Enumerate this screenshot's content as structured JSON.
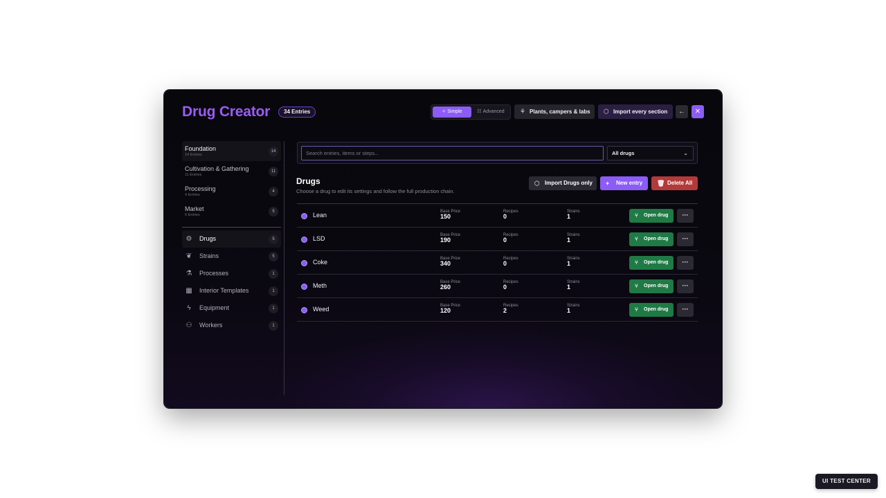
{
  "header": {
    "title": "Drug Creator",
    "entries_badge": "34 Entries",
    "mode": {
      "simple_label": "Simple",
      "advanced_label": "Advanced",
      "selected": "Simple"
    },
    "plants_button": "Plants, campers & labs",
    "import_all_button": "Import every section",
    "back_icon": "←",
    "close_icon": "✕"
  },
  "sidebar": {
    "sections": [
      {
        "name": "Foundation",
        "sub": "14 Entries",
        "count": "14"
      },
      {
        "name": "Cultivation & Gathering",
        "sub": "11 Entries",
        "count": "11"
      },
      {
        "name": "Processing",
        "sub": "4 Entries",
        "count": "4"
      },
      {
        "name": "Market",
        "sub": "5 Entries",
        "count": "5"
      }
    ],
    "categories": [
      {
        "label": "Drugs",
        "count": "5",
        "icon": "gear-icon"
      },
      {
        "label": "Strains",
        "count": "5",
        "icon": "leaf-icon"
      },
      {
        "label": "Processes",
        "count": "1",
        "icon": "flask-icon"
      },
      {
        "label": "Interior Templates",
        "count": "1",
        "icon": "building-icon"
      },
      {
        "label": "Equipment",
        "count": "1",
        "icon": "bolt-icon"
      },
      {
        "label": "Workers",
        "count": "1",
        "icon": "users-icon"
      }
    ]
  },
  "search": {
    "placeholder": "Search entries, items or steps...",
    "filter_value": "All drugs"
  },
  "main": {
    "title": "Drugs",
    "subtitle": "Choose a drug to edit its settings and follow the full production chain.",
    "import_button": "Import Drugs only",
    "new_button": "New entry",
    "delete_button": "Delete All",
    "columns": {
      "price": "Base Price",
      "recipes": "Recipes",
      "strains": "Strains"
    },
    "open_label": "Open drug",
    "more_label": "···",
    "rows": [
      {
        "name": "Lean",
        "price": "150",
        "recipes": "0",
        "strains": "1"
      },
      {
        "name": "LSD",
        "price": "190",
        "recipes": "0",
        "strains": "1"
      },
      {
        "name": "Coke",
        "price": "340",
        "recipes": "0",
        "strains": "1"
      },
      {
        "name": "Meth",
        "price": "260",
        "recipes": "0",
        "strains": "1"
      },
      {
        "name": "Weed",
        "price": "120",
        "recipes": "2",
        "strains": "1"
      }
    ]
  },
  "footer_badge": "UI TEST CENTER",
  "colors": {
    "accent": "#8b5cf6",
    "success": "#1f7a45",
    "danger": "#b33a3a"
  }
}
